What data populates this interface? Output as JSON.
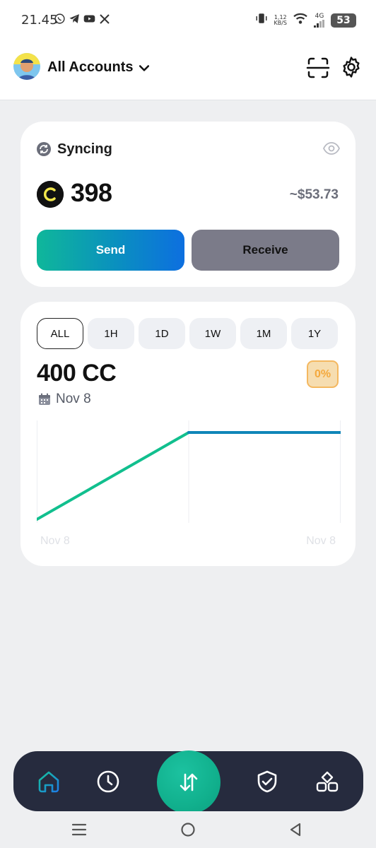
{
  "status_bar": {
    "time": "21.45",
    "net_speed_value": "1,12",
    "net_speed_unit": "KB/S",
    "network_type": "4G",
    "battery": "53"
  },
  "header": {
    "title": "All Accounts"
  },
  "balance_card": {
    "status_label": "Syncing",
    "amount": "398",
    "fiat_value": "~$53.73",
    "send_label": "Send",
    "receive_label": "Receive"
  },
  "chart_card": {
    "tabs": [
      "ALL",
      "1H",
      "1D",
      "1W",
      "1M",
      "1Y"
    ],
    "active_tab": "ALL",
    "value": "400 CC",
    "change": "0%",
    "date": "Nov 8",
    "x_labels": [
      "Nov 8",
      "Nov 8"
    ]
  },
  "chart_data": {
    "type": "line",
    "x": [
      0,
      1,
      2
    ],
    "values": [
      0,
      1,
      1
    ],
    "xlabel": "",
    "ylabel": "",
    "tick_labels": [
      "Nov 8",
      "Nov 8"
    ],
    "colors": {
      "rising": "#11bf8e",
      "flat": "#0f86b8"
    },
    "grid": false
  },
  "colors": {
    "accent_green": "#11b08d",
    "accent_blue": "#0d6fe0",
    "nav_background": "#262b3e",
    "badge_orange": "#f4a93e"
  }
}
